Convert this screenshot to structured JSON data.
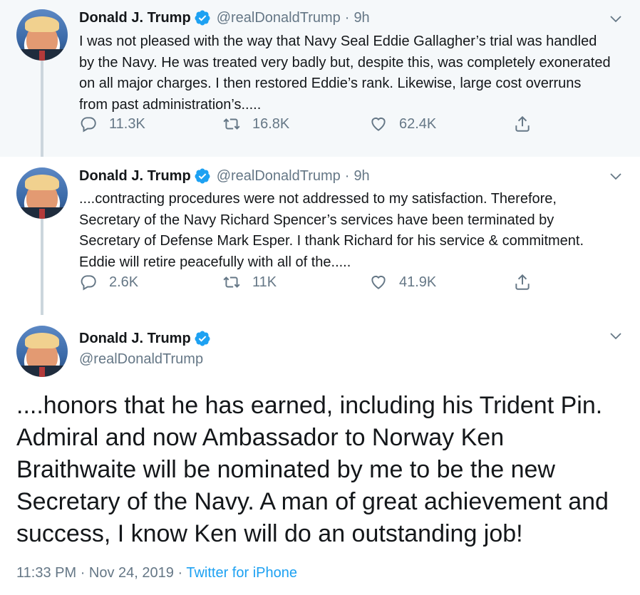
{
  "colors": {
    "text": "#14171a",
    "secondary": "#657786",
    "link": "#1da1f2",
    "highlight_bg": "#f5f8fa",
    "thread_line": "#ccd6dd"
  },
  "tweets": [
    {
      "name": "Donald J. Trump",
      "handle": "@realDonaldTrump",
      "separator": "·",
      "time": "9h",
      "text": "I was not pleased with the way that Navy Seal Eddie Gallagher’s trial was handled by the Navy. He was treated very badly but, despite this, was completely exonerated on all major charges. I then restored Eddie’s rank. Likewise, large cost overruns from past administration’s.....",
      "replies": "11.3K",
      "retweets": "16.8K",
      "likes": "62.4K"
    },
    {
      "name": "Donald J. Trump",
      "handle": "@realDonaldTrump",
      "separator": "·",
      "time": "9h",
      "text": "....contracting procedures were not addressed to my satisfaction. Therefore, Secretary of the Navy Richard Spencer’s services have been terminated by Secretary of Defense Mark Esper. I thank Richard for his service & commitment. Eddie will retire peacefully with all of the.....",
      "replies": "2.6K",
      "retweets": "11K",
      "likes": "41.9K"
    },
    {
      "name": "Donald J. Trump",
      "handle": "@realDonaldTrump",
      "text": "....honors that he has earned, including his Trident Pin. Admiral and now Ambassador to Norway Ken Braithwaite will be nominated by me to be the new Secretary of the Navy. A man of great achievement and success, I know Ken will do an outstanding job!",
      "time": "11:33 PM",
      "separator": "·",
      "date": "Nov 24, 2019",
      "source": "Twitter for iPhone"
    }
  ],
  "icons": {
    "verified": "verified-badge-icon",
    "chevron": "chevron-down-icon",
    "reply": "reply-icon",
    "retweet": "retweet-icon",
    "like": "heart-icon",
    "share": "share-icon"
  }
}
